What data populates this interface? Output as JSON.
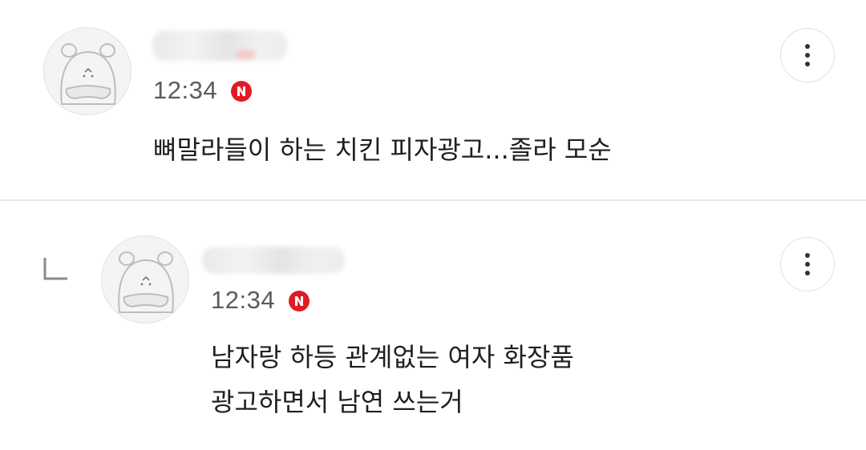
{
  "comments": [
    {
      "time": "12:34",
      "badge": "N",
      "lines": [
        "뼈말라들이 하는 치킨 피자광고...졸라 모순"
      ],
      "is_reply": false
    },
    {
      "time": "12:34",
      "badge": "N",
      "lines": [
        "남자랑 하등 관계없는 여자 화장품",
        "광고하면서 남연 쓰는거"
      ],
      "is_reply": true
    }
  ],
  "icons": {
    "more": "more-vertical-icon",
    "reply": "reply-indicator-icon",
    "avatar": "default-avatar-icon",
    "new": "new-badge"
  },
  "colors": {
    "badge": "#e01b24",
    "divider": "#e6e6e6",
    "time": "#5b5b5b"
  }
}
